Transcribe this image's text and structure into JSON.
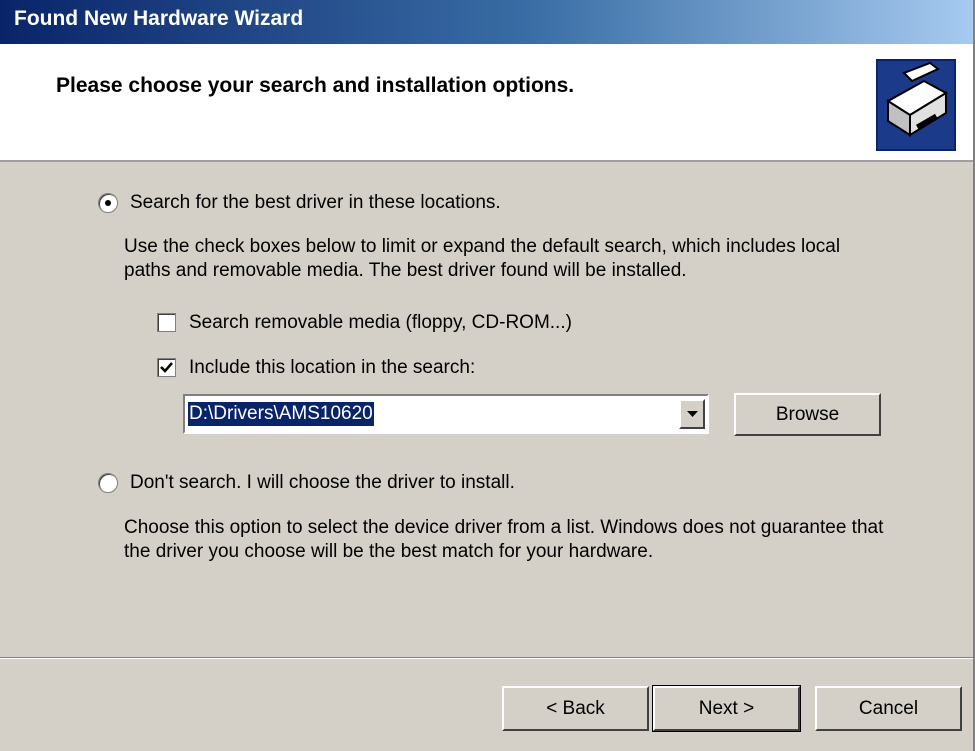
{
  "window": {
    "title": "Found New Hardware Wizard"
  },
  "header": {
    "title": "Please choose your search and installation options.",
    "icon": "hardware-install-icon"
  },
  "options": {
    "search": {
      "label": "Search for the best driver in these locations.",
      "selected": true,
      "description_line1": "Use the check boxes below to limit or expand the default search, which includes local",
      "description_line2": "paths and removable media. The best driver found will be installed.",
      "removable_media": {
        "label": "Search removable media (floppy, CD-ROM...)",
        "checked": false
      },
      "include_location": {
        "label": "Include this location in the search:",
        "checked": true
      },
      "location_value": "D:\\Drivers\\AMS10620",
      "browse_label": "Browse"
    },
    "dont_search": {
      "label": "Don't search. I will choose the driver to install.",
      "selected": false,
      "description_line1": "Choose this option to select the device driver from a list.  Windows does not guarantee that",
      "description_line2": "the driver you choose will be the best match for your hardware."
    }
  },
  "footer": {
    "back_label": "< Back",
    "next_label": "Next >",
    "cancel_label": "Cancel"
  },
  "colors": {
    "titlebar_start": "#0a246a",
    "titlebar_end": "#a6caf0",
    "dialog_bg": "#d4d0c8",
    "selection": "#0a246a"
  }
}
